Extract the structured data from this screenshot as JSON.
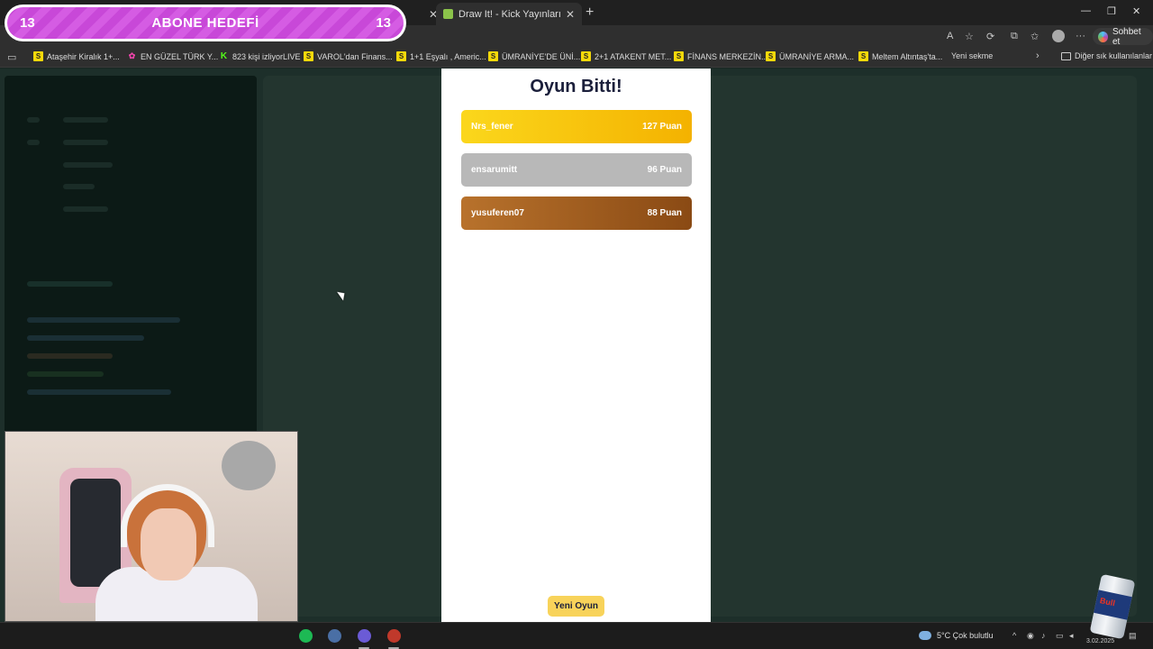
{
  "browser": {
    "tabs": [
      {
        "label": "Draw It! - Kick Yayınları İçin Çizim ...",
        "active": true
      }
    ],
    "copilot_label": "Sohbet et",
    "bookmarks": [
      {
        "label": "Ataşehir Kiralık 1+...",
        "icon": "S"
      },
      {
        "label": "EN GÜZEL TÜRK Y...",
        "icon": "flower"
      },
      {
        "label": "823 kişi izliyorLIVE",
        "icon": "K"
      },
      {
        "label": "VAROL'dan Finans...",
        "icon": "S"
      },
      {
        "label": "1+1 Eşyalı , Americ...",
        "icon": "S"
      },
      {
        "label": "ÜMRANİYE'DE ÜNİ...",
        "icon": "S"
      },
      {
        "label": "2+1 ATAKENT MET...",
        "icon": "S"
      },
      {
        "label": "FİNANS MERKEZİN...",
        "icon": "S"
      },
      {
        "label": "ÜMRANİYE ARMA...",
        "icon": "S"
      },
      {
        "label": "Meltem Altıntaş'ta...",
        "icon": "S"
      },
      {
        "label": "Yeni sekme",
        "icon": "page"
      }
    ],
    "bookmarks_folder": "Diğer sık kullanılanlar"
  },
  "game": {
    "title": "Oyun Bitti!",
    "scores": [
      {
        "name": "Nrs_fener",
        "points": "127 Puan",
        "rank": "gold"
      },
      {
        "name": "ensarumitt",
        "points": "96 Puan",
        "rank": "silver"
      },
      {
        "name": "yusuferen07",
        "points": "88 Puan",
        "rank": "bronze"
      }
    ],
    "new_game_label": "Yeni Oyun"
  },
  "overlay": {
    "goal_label": "ABONE HEDEFİ",
    "goal_current": "13",
    "goal_target": "13"
  },
  "taskbar": {
    "weather": "5°C  Çok bulutlu",
    "date": "3.02.2025"
  },
  "colors": {
    "gold": "#f4b200",
    "silver": "#b8b8b8",
    "bronze": "#8a4a14",
    "new_game": "#f8d35a",
    "goal_pink": "#c848d8"
  }
}
